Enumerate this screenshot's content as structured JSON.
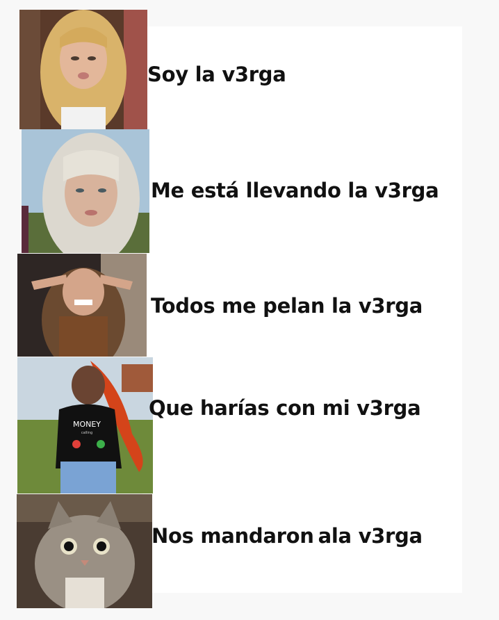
{
  "rows": [
    {
      "caption": "Soy la v3rga",
      "photo": "blonde-woman-photo"
    },
    {
      "caption": "Me está llevando la v3rga",
      "photo": "platinum-bangs-woman-photo"
    },
    {
      "caption": "Todos me pelan la v3rga",
      "photo": "grimacing-woman-photo"
    },
    {
      "caption": "Que harías con mi v3rga",
      "photo": "money-shirt-woman-photo"
    },
    {
      "caption_part1": "Nos mandaron",
      "caption_part2": "ala v3rga",
      "photo": "tabby-cat-photo"
    }
  ],
  "shirt_text": "MONEY",
  "shirt_subtext": "calling"
}
